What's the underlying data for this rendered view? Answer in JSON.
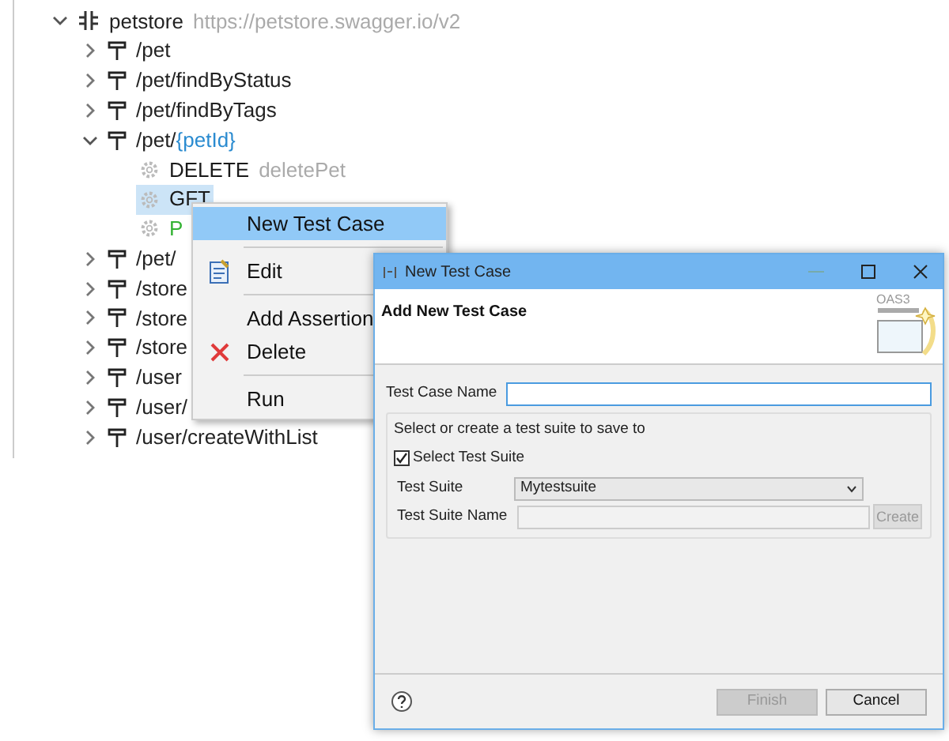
{
  "tree": {
    "root": {
      "name": "petstore",
      "url": "https://petstore.swagger.io/v2",
      "expanded": true,
      "children": [
        {
          "path": "/pet",
          "expanded": false
        },
        {
          "path": "/pet/findByStatus",
          "expanded": false
        },
        {
          "path": "/pet/findByTags",
          "expanded": false
        },
        {
          "path": "/pet/",
          "param": "{petId}",
          "expanded": true,
          "children": [
            {
              "method": "DELETE",
              "operation": "deletePet",
              "color": "#1a1a1a",
              "selected": false
            },
            {
              "method": "GFT",
              "color": "#1a1a1a",
              "selected": true
            },
            {
              "method": "P",
              "color": "#33b233",
              "selected": false
            }
          ]
        },
        {
          "path": "/pet/",
          "expanded": false
        },
        {
          "path": "/store",
          "expanded": false
        },
        {
          "path": "/store",
          "expanded": false
        },
        {
          "path": "/store",
          "expanded": false
        },
        {
          "path": "/user",
          "expanded": false
        },
        {
          "path": "/user/",
          "expanded": false
        },
        {
          "path": "/user/createWithList",
          "expanded": false
        }
      ]
    }
  },
  "context_menu": [
    {
      "kind": "item",
      "label": "New Test Case",
      "selected": true
    },
    {
      "kind": "separator"
    },
    {
      "kind": "edit",
      "label": "Edit",
      "selected": false
    },
    {
      "kind": "separator"
    },
    {
      "kind": "item",
      "label": "Add Assertion",
      "selected": false
    },
    {
      "kind": "delete",
      "label": "Delete",
      "selected": false
    },
    {
      "kind": "separator"
    },
    {
      "kind": "item",
      "label": "Run",
      "selected": false
    }
  ],
  "dialog": {
    "title": "New Test Case",
    "heading": "Add New Test Case",
    "badge": "OAS3",
    "name_label": "Test Case Name",
    "group_caption": "Select or create a test suite to save to",
    "select_suite": {
      "label": "Select Test Suite",
      "checked": true
    },
    "suite_label": "Test Suite",
    "suite_value": "Mytestsuite",
    "suite_name_label": "Test Suite Name",
    "suite_name_disabled": true,
    "create": {
      "label": "Create",
      "disabled": true
    },
    "buttons": [
      {
        "label": "Finish",
        "disabled": true
      },
      {
        "label": "Cancel",
        "disabled": false
      }
    ]
  }
}
